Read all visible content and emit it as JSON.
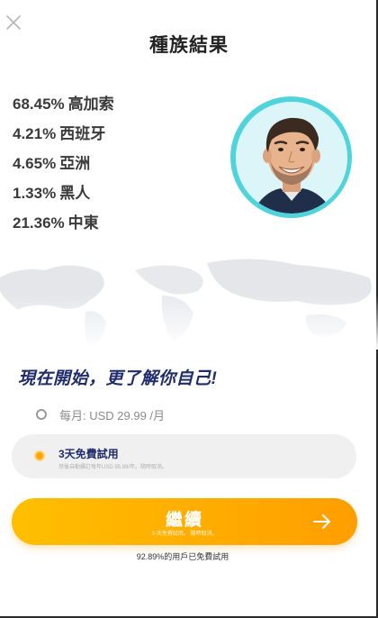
{
  "header": {
    "title": "種族結果",
    "close_icon": "close-icon"
  },
  "results": [
    {
      "percent": "68.45%",
      "label": "高加索"
    },
    {
      "percent": "4.21%",
      "label": "西班牙"
    },
    {
      "percent": "4.65%",
      "label": "亞洲"
    },
    {
      "percent": "1.33%",
      "label": "黑人"
    },
    {
      "percent": "21.36%",
      "label": "中東"
    }
  ],
  "avatar": {
    "icon": "face-avatar",
    "ring_color": "#4fd4dc"
  },
  "offer": {
    "headline": "現在開始，更了解你自己!",
    "monthly_label": "每月: USD 29.99 /月",
    "trial_title": "3天免費試用",
    "trial_subtitle": "然後自動續訂每年USD 95.99/年。隨時取消。",
    "trial_selected": true
  },
  "cta": {
    "label": "繼續",
    "sublabel": "3-天免費試用。 隨時取消。",
    "arrow_icon": "arrow-right-icon",
    "color_start": "#ffbf00",
    "color_end": "#ff9e00"
  },
  "footnote": "92.89%的用戶已免費試用"
}
